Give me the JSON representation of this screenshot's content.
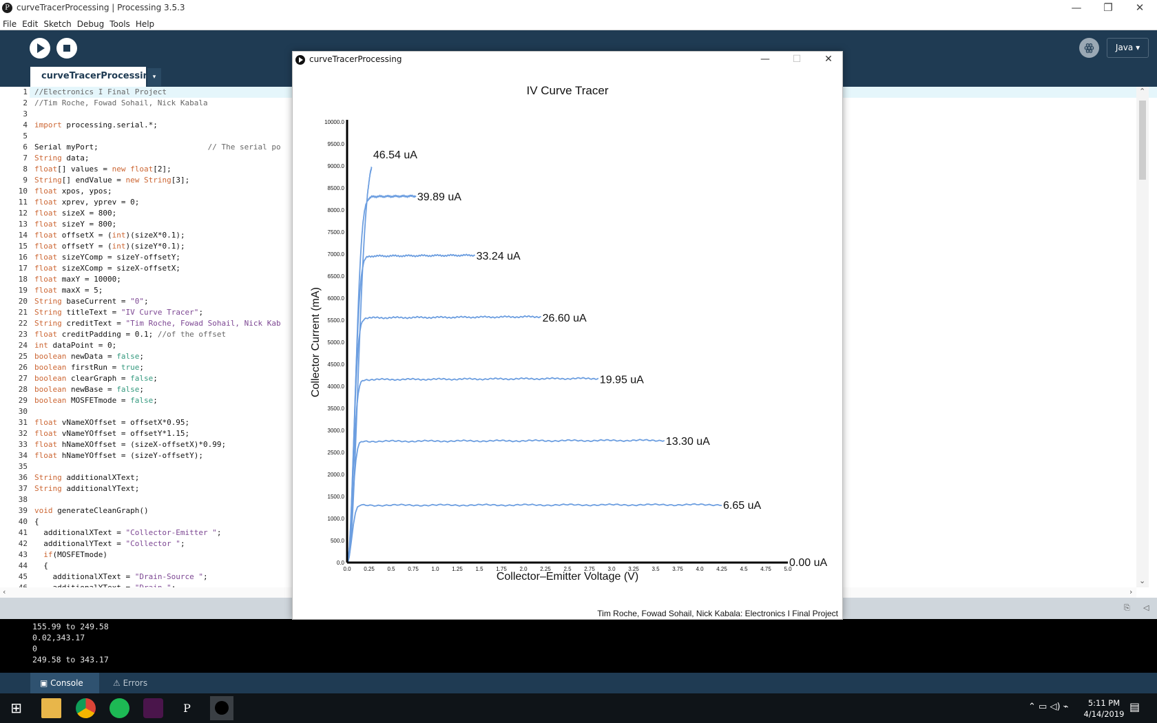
{
  "ide": {
    "window_title": "curveTracerProcessing | Processing 3.5.3",
    "menu": [
      "File",
      "Edit",
      "Sketch",
      "Debug",
      "Tools",
      "Help"
    ],
    "mode": "Java ▾",
    "tab_label": "curveTracerProcessing",
    "tab_menu_glyph": "▾",
    "code_lines": [
      "//Electronics I Final Project",
      "//Tim Roche, Fowad Sohail, Nick Kabala",
      "",
      "import processing.serial.*;",
      "",
      "Serial myPort;                        // The serial po",
      "String data;",
      "float[] values = new float[2];",
      "String[] endValue = new String[3];",
      "float xpos, ypos;",
      "float xprev, yprev = 0;",
      "float sizeX = 800;",
      "float sizeY = 800;",
      "float offsetX = (int)(sizeX*0.1);",
      "float offsetY = (int)(sizeY*0.1);",
      "float sizeYComp = sizeY-offsetY;",
      "float sizeXComp = sizeX-offsetX;",
      "float maxY = 10000;",
      "float maxX = 5;",
      "String baseCurrent = \"0\";",
      "String titleText = \"IV Curve Tracer\";",
      "String creditText = \"Tim Roche, Fowad Sohail, Nick Kab",
      "float creditPadding = 0.1; //of the offset",
      "int dataPoint = 0;",
      "boolean newData = false;",
      "boolean firstRun = true;",
      "boolean clearGraph = false;",
      "boolean newBase = false;",
      "boolean MOSFETmode = false;",
      "",
      "float vNameXOffset = offsetX*0.95;",
      "float vNameYOffset = offsetY*1.15;",
      "float hNameXOffset = (sizeX-offsetX)*0.99;",
      "float hNameYOffset = (sizeY-offsetY);",
      "",
      "String additionalXText;",
      "String additionalYText;",
      "",
      "void generateCleanGraph()",
      "{",
      "  additionalXText = \"Collector-Emitter \";",
      "  additionalYText = \"Collector \";",
      "  if(MOSFETmode)",
      "  {",
      "    additionalXText = \"Drain-Source \";",
      "    additionalYText = \"Drain \";"
    ],
    "console_lines": [
      "155.99 to 249.58",
      "0.02,343.17",
      "0",
      "249.58 to 343.17"
    ],
    "console_tabs": [
      "Console",
      "Errors"
    ]
  },
  "sketch": {
    "window_title": "curveTracerProcessing",
    "credit": "Tim Roche, Fowad Sohail, Nick Kabala: Electronics I Final Project"
  },
  "chart_data": {
    "type": "line",
    "title": "IV Curve Tracer",
    "xlabel": "Collector–Emitter Voltage (V)",
    "ylabel": "Collector Current (mA)",
    "xlim": [
      0,
      5
    ],
    "ylim": [
      0,
      10000
    ],
    "x_ticks": [
      "0.0",
      "0.25",
      "0.5",
      "0.75",
      "1.0",
      "1.25",
      "1.5",
      "1.75",
      "2.0",
      "2.25",
      "2.5",
      "2.75",
      "3.0",
      "3.25",
      "3.5",
      "3.75",
      "4.0",
      "4.25",
      "4.5",
      "4.75",
      "5.0"
    ],
    "y_ticks": [
      "0.0",
      "500.0",
      "1000.0",
      "1500.0",
      "2000.0",
      "2500.0",
      "3000.0",
      "3500.0",
      "4000.0",
      "4500.0",
      "5000.0",
      "5500.0",
      "6000.0",
      "6500.0",
      "7000.0",
      "7500.0",
      "8000.0",
      "8500.0",
      "9000.0",
      "9500.0",
      "10000.0"
    ],
    "line_color": "#6c9ee0",
    "series": [
      {
        "name": "0.00 uA",
        "x_end": 5.0,
        "y_sat": 0,
        "knee": 0.1
      },
      {
        "name": "6.65 uA",
        "x_end": 4.25,
        "y_sat": 1300,
        "knee": 0.1
      },
      {
        "name": "13.30 uA",
        "x_end": 3.6,
        "y_sat": 2750,
        "knee": 0.11
      },
      {
        "name": "19.95 uA",
        "x_end": 2.85,
        "y_sat": 4150,
        "knee": 0.12
      },
      {
        "name": "26.60 uA",
        "x_end": 2.2,
        "y_sat": 5550,
        "knee": 0.13
      },
      {
        "name": "33.24 uA",
        "x_end": 1.45,
        "y_sat": 6950,
        "knee": 0.15
      },
      {
        "name": "39.89 uA",
        "x_end": 0.78,
        "y_sat": 8300,
        "knee": 0.17
      },
      {
        "name": "46.54 uA",
        "x_end": 0.28,
        "y_sat": 9250,
        "knee": 0.23
      }
    ]
  },
  "taskbar": {
    "time": "5:11 PM",
    "date": "4/14/2019"
  }
}
